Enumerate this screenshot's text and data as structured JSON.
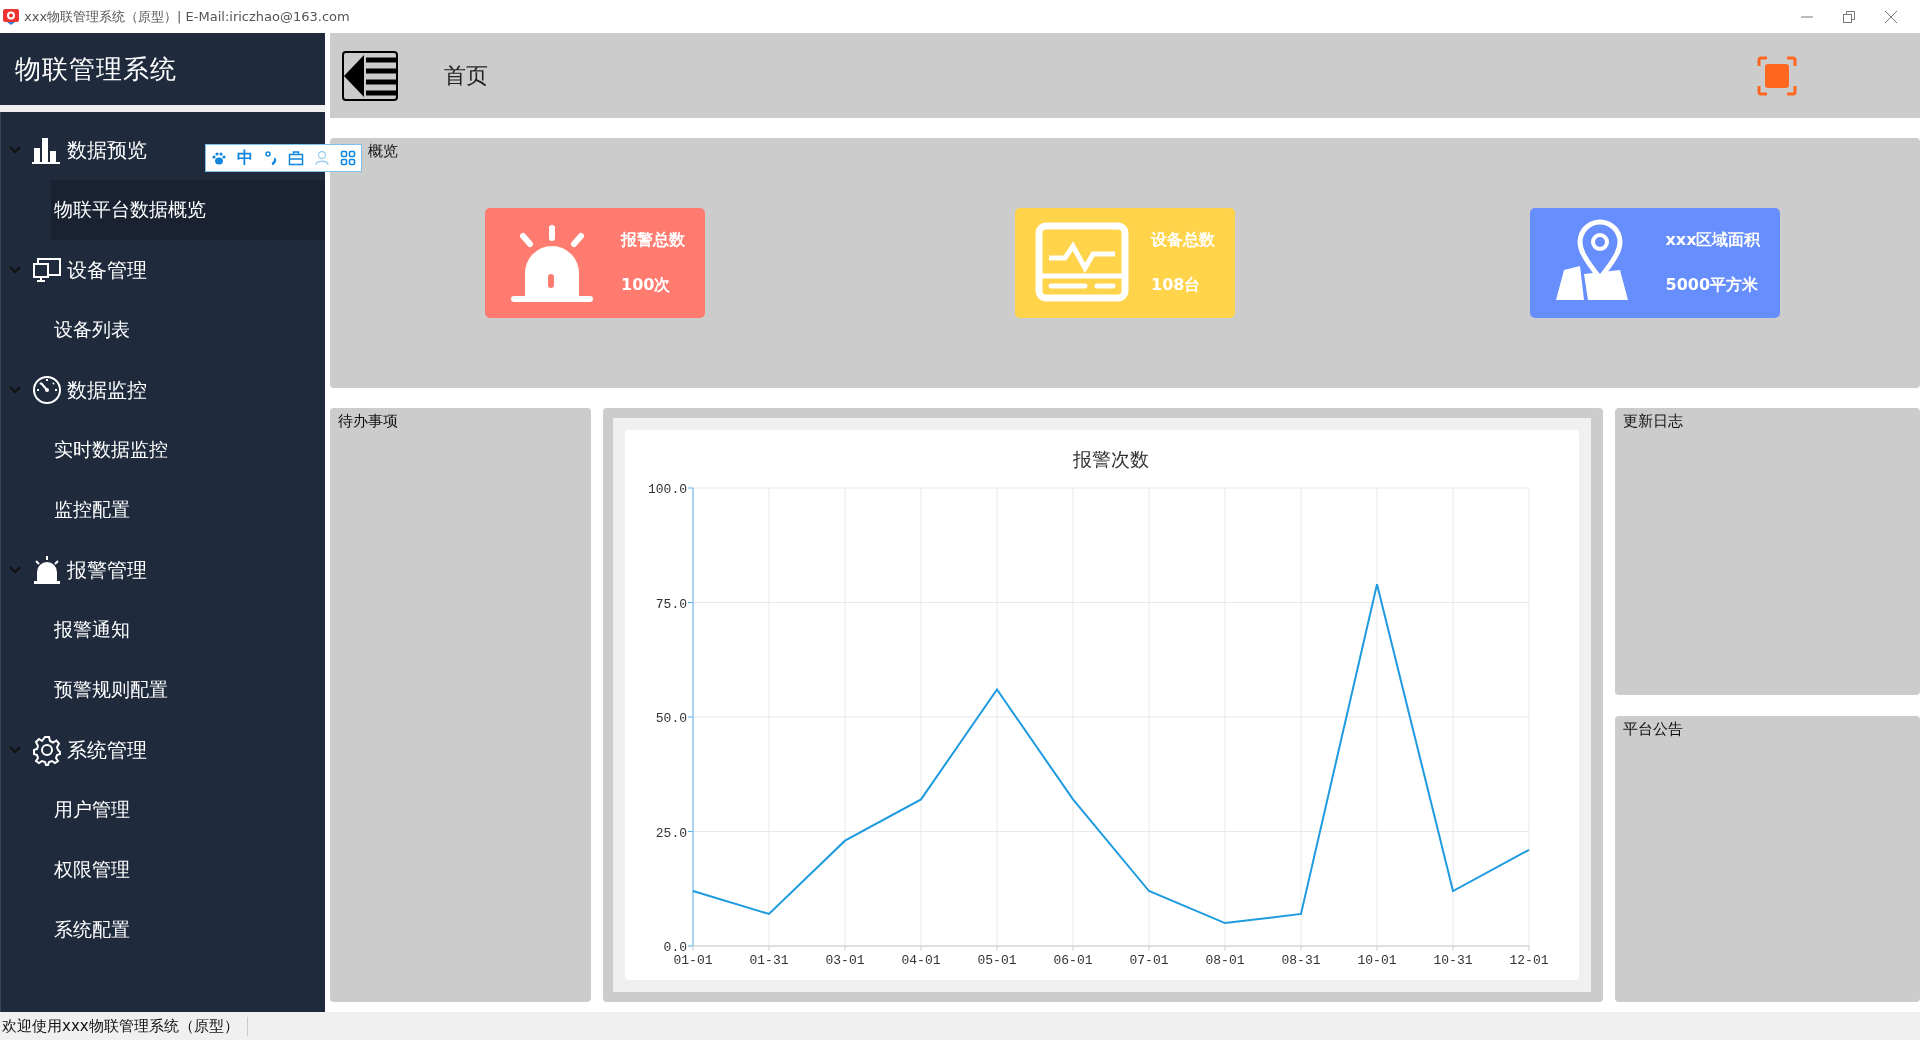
{
  "window": {
    "title": "xxx物联管理系统（原型）| E-Mail:iriczhao@163.com"
  },
  "sidebar": {
    "title": "物联管理系统",
    "menu": [
      {
        "label": "数据预览",
        "expanded": true,
        "children": [
          {
            "label": "物联平台数据概览",
            "selected": true
          }
        ]
      },
      {
        "label": "设备管理",
        "expanded": true,
        "children": [
          {
            "label": "设备列表",
            "selected": false
          }
        ]
      },
      {
        "label": "数据监控",
        "expanded": true,
        "children": [
          {
            "label": "实时数据监控",
            "selected": false
          },
          {
            "label": "监控配置",
            "selected": false
          }
        ]
      },
      {
        "label": "报警管理",
        "expanded": true,
        "children": [
          {
            "label": "报警通知",
            "selected": false
          },
          {
            "label": "预警规则配置",
            "selected": false
          }
        ]
      },
      {
        "label": "系统管理",
        "expanded": true,
        "children": [
          {
            "label": "用户管理",
            "selected": false
          },
          {
            "label": "权限管理",
            "selected": false
          },
          {
            "label": "系统配置",
            "selected": false
          }
        ]
      }
    ]
  },
  "ime_toolbar": {
    "mode": "中"
  },
  "header": {
    "title": "首页"
  },
  "overview": {
    "title": "概览",
    "cards": [
      {
        "label": "报警总数",
        "value": "100次",
        "color": "#ff7b70"
      },
      {
        "label": "设备总数",
        "value": "108台",
        "color": "#ffd34a"
      },
      {
        "label": "xxx区域面积",
        "value": "5000平方米",
        "color": "#678efd"
      }
    ]
  },
  "todo": {
    "title": "待办事项"
  },
  "chart_panel": {
    "chart_data": {
      "type": "line",
      "title": "报警次数",
      "categories": [
        "01-01",
        "01-31",
        "03-01",
        "04-01",
        "05-01",
        "06-01",
        "07-01",
        "08-01",
        "08-31",
        "10-01",
        "10-31",
        "12-01"
      ],
      "series": [
        {
          "color": "#1e9be0",
          "values": [
            12,
            7,
            23,
            32,
            56,
            32,
            12,
            5,
            7,
            79,
            12,
            21
          ]
        }
      ],
      "ylim": [
        0,
        100
      ],
      "yticks": [
        {
          "value": 0,
          "label": "0.0"
        },
        {
          "value": 25,
          "label": "25.0"
        },
        {
          "value": 50,
          "label": "50.0"
        },
        {
          "value": 75,
          "label": "75.0"
        },
        {
          "value": 100,
          "label": "100.0"
        }
      ],
      "grid": true
    }
  },
  "changelog": {
    "title": "更新日志"
  },
  "notice": {
    "title": "平台公告"
  },
  "status_bar": {
    "text": "欢迎使用xxx物联管理系统（原型）"
  }
}
